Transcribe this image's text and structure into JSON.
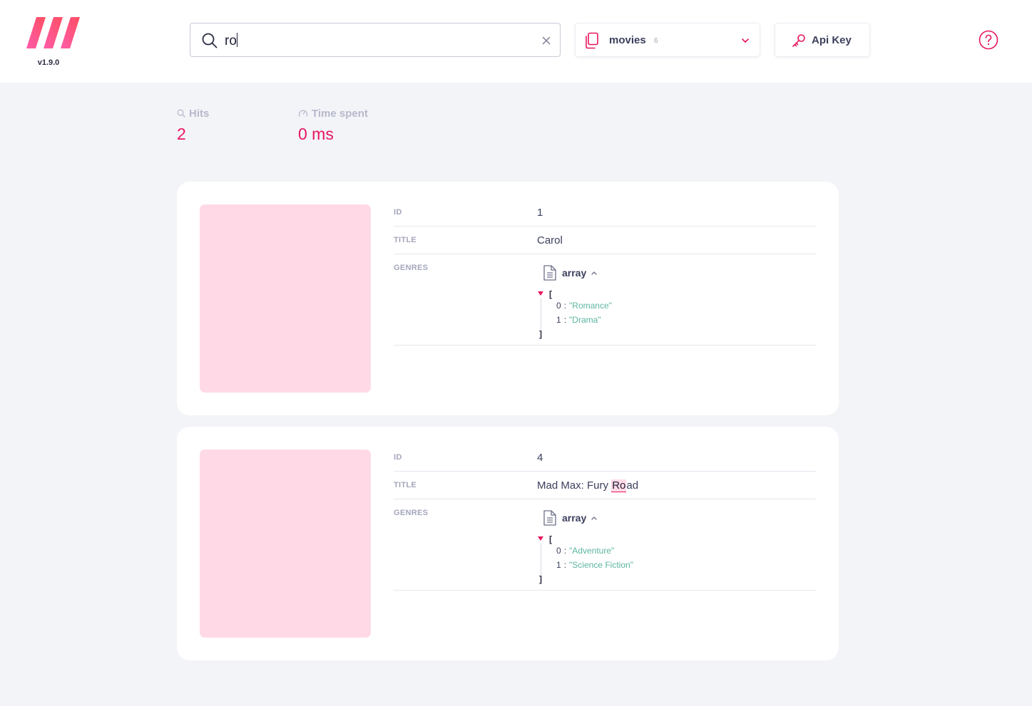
{
  "header": {
    "version": "v1.9.0",
    "search": {
      "query": "ro"
    },
    "index": {
      "name": "movies",
      "count": "6"
    },
    "api_key_label": "Api Key"
  },
  "stats": {
    "hits_label": "Hits",
    "hits_value": "2",
    "time_label": "Time spent",
    "time_value": "0 ms"
  },
  "labels": {
    "id": "ID",
    "title": "TITLE",
    "genres": "GENRES",
    "array_type": "array",
    "open_bracket": "[",
    "close_bracket": "]",
    "colon": ":"
  },
  "results": [
    {
      "id": "1",
      "title": "Carol",
      "genres": [
        {
          "index": "0",
          "value": "\"Romance\""
        },
        {
          "index": "1",
          "value": "\"Drama\""
        }
      ]
    },
    {
      "id": "4",
      "title_before": "Mad Max: Fury ",
      "title_highlight": "Ro",
      "title_after": "ad",
      "genres": [
        {
          "index": "0",
          "value": "\"Adventure\""
        },
        {
          "index": "1",
          "value": "\"Science Fiction\""
        }
      ]
    }
  ],
  "colors": {
    "accent": "#e8175d",
    "poster_placeholder": "#ffdae6",
    "string_value": "#5bb59f",
    "background": "#f3f4f8"
  }
}
